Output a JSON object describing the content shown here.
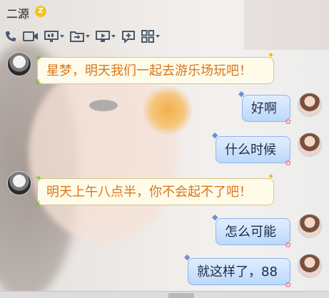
{
  "header": {
    "contact_name": "二源",
    "vip_badge": "Z"
  },
  "toolbar": {
    "icons": [
      "phone-icon",
      "video-icon",
      "screen-share-icon",
      "file-transfer-icon",
      "remote-desktop-icon",
      "add-chat-icon",
      "apps-grid-icon"
    ]
  },
  "messages": [
    {
      "side": "left",
      "text": "星梦，明天我们一起去游乐场玩吧！"
    },
    {
      "side": "right",
      "text": "好啊"
    },
    {
      "side": "right",
      "text": "什么时候"
    },
    {
      "side": "left",
      "text": "明天上午八点半，你不会起不了吧！"
    },
    {
      "side": "right",
      "text": "怎么可能"
    },
    {
      "side": "right",
      "text": "就这样了，88"
    }
  ],
  "colors": {
    "left_bubble_bg": "#fffbe9",
    "left_text": "#d9751a",
    "right_bubble_bg": "#cfe4fc",
    "right_text": "#1f2a40",
    "vip_badge": "#f6c21a",
    "toolbar_icon": "#4a5a6a"
  }
}
